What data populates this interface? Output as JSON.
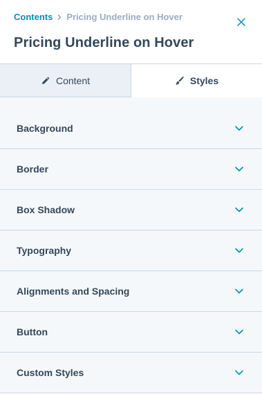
{
  "header": {
    "breadcrumb_root": "Contents",
    "breadcrumb_current": "Pricing Underline on Hover",
    "title": "Pricing Underline on Hover",
    "close_icon": "close-icon"
  },
  "tabs": [
    {
      "label": "Content",
      "icon": "pencil-icon",
      "active": false
    },
    {
      "label": "Styles",
      "icon": "brush-icon",
      "active": true
    }
  ],
  "sections": [
    {
      "label": "Background"
    },
    {
      "label": "Border"
    },
    {
      "label": "Box Shadow"
    },
    {
      "label": "Typography"
    },
    {
      "label": "Alignments and Spacing"
    },
    {
      "label": "Button"
    },
    {
      "label": "Custom Styles"
    }
  ],
  "colors": {
    "accent": "#0091ae",
    "text": "#33475b",
    "muted": "#99acc2",
    "border": "#cbd6e2",
    "tab_inactive_bg": "#eaf0f6",
    "list_bg": "#f5f8fa"
  }
}
